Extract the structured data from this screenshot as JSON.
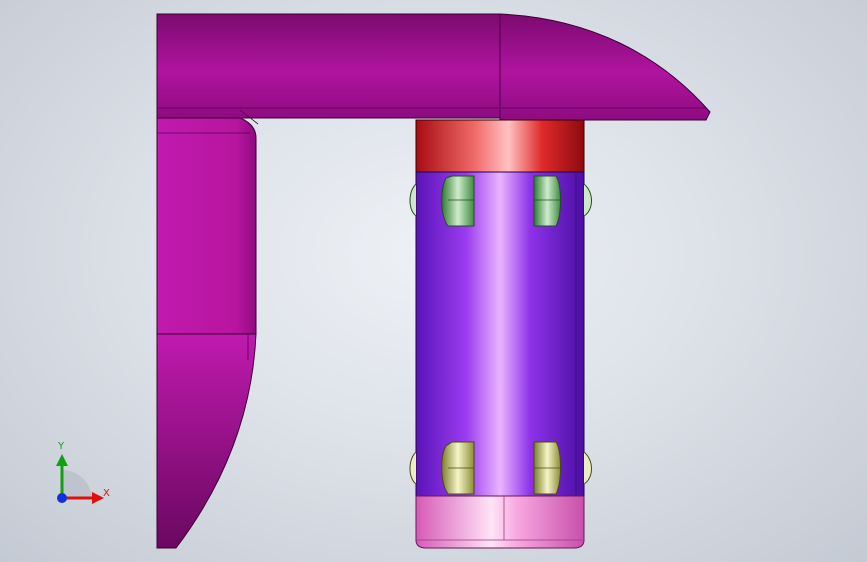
{
  "viewport": {
    "background_top": "#eef1f5",
    "background_edge": "#c4cad3"
  },
  "model": {
    "bracket_color": "#b0149f",
    "cap_color": "#c0141e",
    "sleeve_color": "#7a1fd1",
    "ring_color": "#f07bd2",
    "bearing_top_color": "#69b86a",
    "bearing_bottom_color": "#c5c57a"
  },
  "triad": {
    "x_label": "X",
    "y_label": "Y",
    "x_color": "#e01010",
    "y_color": "#10a010",
    "z_color": "#1030e0"
  }
}
